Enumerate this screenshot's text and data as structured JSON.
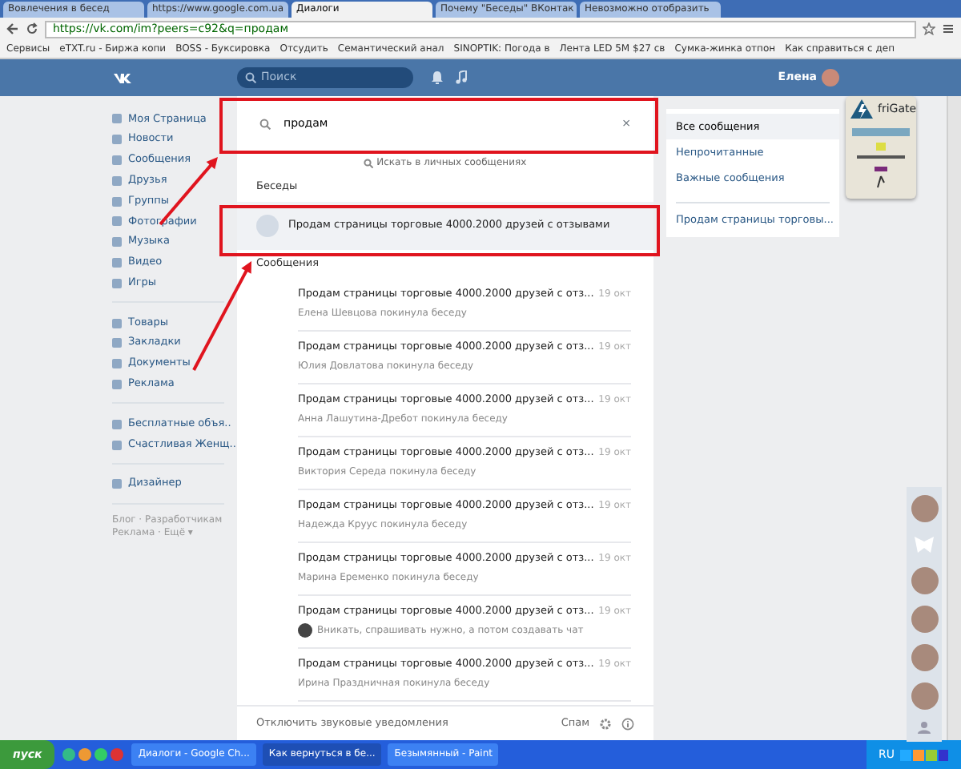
{
  "browser": {
    "tabs": [
      {
        "label": "Вовлечения в бесед",
        "selected": false
      },
      {
        "label": "https://www.google.com.ua",
        "selected": false
      },
      {
        "label": "Диалоги",
        "selected": true
      },
      {
        "label": "Почему \"Беседы\" ВКонтак",
        "selected": false
      },
      {
        "label": "Невозможно отобразить",
        "selected": false
      }
    ],
    "address": "https://vk.com/im?peers=c92&q=продам",
    "bookmarks": [
      "Сервисы",
      "eTXT.ru - Биржа копи",
      "BOSS - Буксировка",
      "Отсудить",
      "Семантический анал",
      "SINOPTIK: Погода в",
      "Лента LED 5M $27 св",
      "Сумка-жинка отпон",
      "Как справиться с деп"
    ]
  },
  "header": {
    "search_placeholder": "Поиск",
    "user_name": "Елена"
  },
  "sidebar": {
    "groups": [
      [
        "Моя Страница",
        "Новости",
        "Сообщения",
        "Друзья",
        "Группы",
        "Фотографии",
        "Музыка",
        "Видео",
        "Игры"
      ],
      [
        "Товары",
        "Закладки",
        "Документы",
        "Реклама"
      ],
      [
        "Бесплатные объя..",
        "Счастливая Женщ.."
      ],
      [
        "Дизайнер"
      ]
    ],
    "footer": [
      "Блог · Разработчикам",
      "Реклама · Ещё ▾"
    ]
  },
  "search": {
    "value": "продам",
    "clear": "×",
    "hint": "Искать в личных сообщениях"
  },
  "conversations": {
    "title": "Беседы",
    "items": [
      {
        "title": "Продам страницы торговые 4000.2000 друзей с отзывами"
      }
    ]
  },
  "messages": {
    "title": "Сообщения",
    "items": [
      {
        "kind": "system",
        "title": "Продам страницы торговые 4000.2000 друзей с отз...",
        "date": "19 окт",
        "preview": "Елена Шевцова покинула беседу"
      },
      {
        "kind": "system",
        "title": "Продам страницы торговые 4000.2000 друзей с отз...",
        "date": "19 окт",
        "preview": "Юлия Довлатова покинула беседу"
      },
      {
        "kind": "system",
        "title": "Продам страницы торговые 4000.2000 друзей с отз...",
        "date": "19 окт",
        "preview": "Анна Лашутина-Дребот покинула беседу"
      },
      {
        "kind": "system",
        "title": "Продам страницы торговые 4000.2000 друзей с отз...",
        "date": "19 окт",
        "preview": "Виктория Середа покинула беседу"
      },
      {
        "kind": "system",
        "title": "Продам страницы торговые 4000.2000 друзей с отз...",
        "date": "19 окт",
        "preview": "Надежда Круус покинула беседу"
      },
      {
        "kind": "system",
        "title": "Продам страницы торговые 4000.2000 друзей с отз...",
        "date": "19 окт",
        "preview": "Марина Еременко покинула беседу"
      },
      {
        "kind": "message",
        "title": "Продам страницы торговые 4000.2000 друзей с отз...",
        "date": "19 окт",
        "preview": "Вникать, спрашивать нужно, а потом создавать чат"
      },
      {
        "kind": "system",
        "title": "Продам страницы торговые 4000.2000 друзей с отз...",
        "date": "19 окт",
        "preview": "Ирина Праздничная покинула беседу"
      }
    ]
  },
  "footer": {
    "mute": "Отключить звуковые уведомления",
    "spam": "Спам"
  },
  "filters": [
    {
      "label": "Все сообщения",
      "selected": true
    },
    {
      "label": "Непрочитанные",
      "selected": false
    },
    {
      "label": "Важные сообщения",
      "selected": false
    }
  ],
  "filter_conversation": "Продам страницы торговы...",
  "extension": {
    "title": "friGate"
  },
  "taskbar": {
    "start": "пуск",
    "windows": [
      {
        "label": "Диалоги - Google Ch...",
        "selected": false
      },
      {
        "label": "Как вернуться в бе...",
        "selected": true
      },
      {
        "label": "Безымянный - Paint",
        "selected": false
      }
    ],
    "lang": "RU"
  }
}
